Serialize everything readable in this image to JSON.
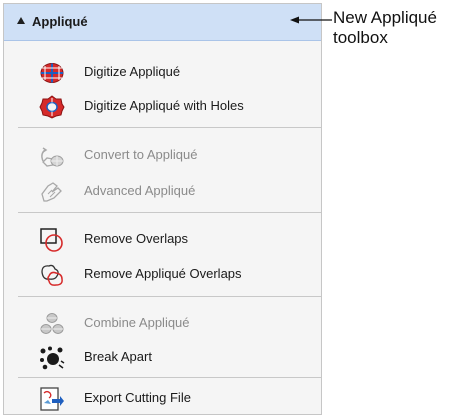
{
  "toolbox": {
    "title": "Appliqué",
    "items": [
      {
        "label": "Digitize Appliqué",
        "icon": "digitize-applique-icon",
        "enabled": true
      },
      {
        "label": "Digitize Appliqué with Holes",
        "icon": "digitize-applique-holes-icon",
        "enabled": true
      },
      {
        "label": "Convert to Appliqué",
        "icon": "convert-to-applique-icon",
        "enabled": false
      },
      {
        "label": "Advanced Appliqué",
        "icon": "advanced-applique-icon",
        "enabled": false
      },
      {
        "label": "Remove Overlaps",
        "icon": "remove-overlaps-icon",
        "enabled": true
      },
      {
        "label": "Remove Appliqué Overlaps",
        "icon": "remove-applique-overlaps-icon",
        "enabled": true
      },
      {
        "label": "Combine Appliqué",
        "icon": "combine-applique-icon",
        "enabled": false
      },
      {
        "label": "Break Apart",
        "icon": "break-apart-icon",
        "enabled": true
      },
      {
        "label": "Export Cutting File",
        "icon": "export-cutting-file-icon",
        "enabled": true
      }
    ]
  },
  "callout": {
    "line1": "New Appliqué",
    "line2": "toolbox"
  },
  "colors": {
    "header_bg": "#cfe0f6",
    "accent_red": "#d62a2a",
    "accent_blue": "#1f5fbf",
    "disabled_text": "#8b8b8b"
  }
}
